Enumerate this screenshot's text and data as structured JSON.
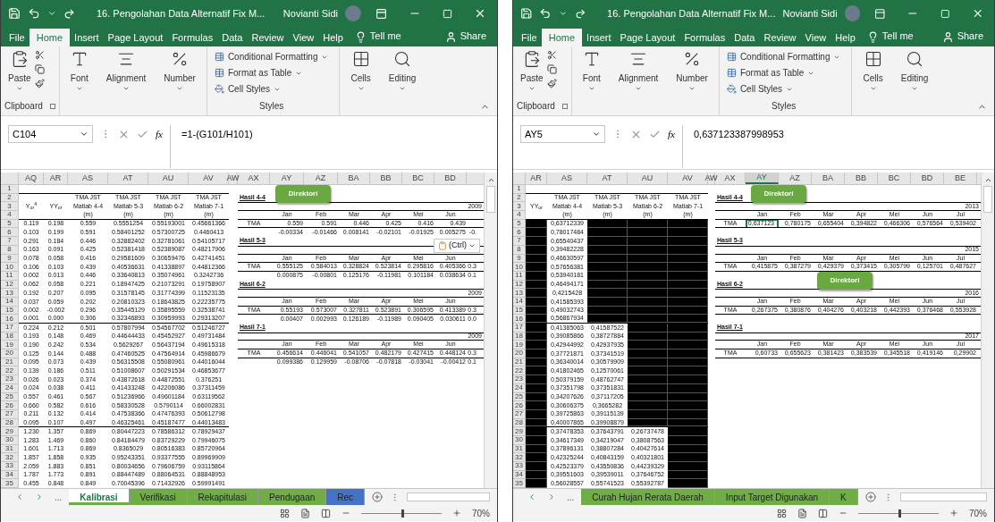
{
  "windows": [
    {
      "title": "16. Pengolahan Data Alternatif Fix M...",
      "user": "Novianti Sidi",
      "tabs": [
        {
          "label": "File",
          "selected": false
        },
        {
          "label": "Home",
          "selected": true
        },
        {
          "label": "Insert",
          "selected": false
        },
        {
          "label": "Page Layout",
          "selected": false
        },
        {
          "label": "Formulas",
          "selected": false
        },
        {
          "label": "Data",
          "selected": false
        },
        {
          "label": "Review",
          "selected": false
        },
        {
          "label": "View",
          "selected": false
        },
        {
          "label": "Help",
          "selected": false
        }
      ],
      "tell_me": "Tell me",
      "share": "Share",
      "ribbon": {
        "paste": "Paste",
        "clipboard": "Clipboard",
        "font": "Font",
        "alignment": "Alignment",
        "number": "Number",
        "styles": [
          "Conditional Formatting",
          "Format as Table",
          "Cell Styles"
        ],
        "styles_label": "Styles",
        "cells": "Cells",
        "editing": "Editing"
      },
      "row_numbers": [
        "1",
        "2",
        "3",
        "4",
        "5",
        "6",
        "7",
        "8",
        "9",
        "10",
        "11",
        "12",
        "13",
        "14",
        "15",
        "16",
        "17",
        "18",
        "19",
        "20",
        "21",
        "22",
        "23",
        "24",
        "25",
        "26",
        "27",
        "28",
        "29",
        "30",
        "31",
        "32",
        "33",
        "34",
        "35"
      ],
      "name_box": "C104",
      "fx": "fx",
      "formula": "=1-(G101/H101)",
      "columns": [
        {
          "name": "AQ",
          "selected": false
        },
        {
          "name": "AR",
          "selected": false
        },
        {
          "name": "AS",
          "selected": false
        },
        {
          "name": "AT",
          "selected": false
        },
        {
          "name": "AU",
          "selected": false
        },
        {
          "name": "AV",
          "selected": false
        },
        {
          "name": "AW",
          "selected": false
        },
        {
          "name": "AX",
          "selected": false
        },
        {
          "name": "AY",
          "selected": false
        },
        {
          "name": "AZ",
          "selected": false
        },
        {
          "name": "BA",
          "selected": false
        },
        {
          "name": "BB",
          "selected": false
        },
        {
          "name": "BC",
          "selected": false
        },
        {
          "name": "BD",
          "selected": false
        }
      ],
      "headers": [
        {
          "lines": [
            "Y$_{or}$$^{4}$"
          ]
        },
        {
          "lines": [
            "YY$_{or}$"
          ]
        },
        {
          "lines": [
            "TMA JST",
            "Matlab 4-4",
            "(m)"
          ]
        },
        {
          "lines": [
            "TMA JST",
            "Matlab 5-3",
            "(m)"
          ]
        },
        {
          "lines": [
            "TMA JST",
            "Matlab 6-2",
            "(m)"
          ]
        },
        {
          "lines": [
            "TMA JST",
            "Matlab 7-1",
            "(m)"
          ]
        }
      ],
      "rows": [
        [
          "0.119",
          "0.198",
          "0.559",
          "0.5551254",
          "0.55193001",
          "0.45661366"
        ],
        [
          "0.103",
          "0.199",
          "0.591",
          "0.58401252",
          "0.57300725",
          "0.4460413"
        ],
        [
          "0.291",
          "0.184",
          "0.446",
          "0.32882402",
          "0.32781061",
          "0.54105717"
        ],
        [
          "0.163",
          "0.091",
          "0.425",
          "0.52381418",
          "0.52389087",
          "0.48217906"
        ],
        [
          "0.078",
          "0.058",
          "0.416",
          "0.29581609",
          "0.30659476",
          "0.42741451"
        ],
        [
          "0.106",
          "0.103",
          "0.439",
          "0.40536631",
          "0.41338897",
          "0.44812366"
        ],
        [
          "0.002",
          "0.013",
          "0.446",
          "0.33640813",
          "0.35074961",
          "0.3242736"
        ],
        [
          "0.062",
          "0.058",
          "0.221",
          "0.18947425",
          "0.21073291",
          "0.19758907"
        ],
        [
          "0.192",
          "0.207",
          "0.095",
          "0.31578145",
          "0.31774399",
          "0.11523135"
        ],
        [
          "0.037",
          "0.059",
          "0.202",
          "0.20810323",
          "0.18643825",
          "0.22235775"
        ],
        [
          "0.002",
          "-0.002",
          "0.296",
          "0.35445129",
          "0.35895559",
          "0.32538741"
        ],
        [
          "0.001",
          "0.000",
          "0.306",
          "0.32346893",
          "0.30959993",
          "0.29313207"
        ],
        [
          "0.224",
          "0.212",
          "0.501",
          "0.57807994",
          "0.54567702",
          "0.51246727"
        ],
        [
          "0.193",
          "0.148",
          "0.469",
          "0.44644433",
          "0.45452927",
          "0.49731484"
        ],
        [
          "0.190",
          "0.242",
          "0.534",
          "0.5629267",
          "0.56437194",
          "0.49615318"
        ],
        [
          "0.125",
          "0.144",
          "0.488",
          "0.47460525",
          "0.47564914",
          "0.45986679"
        ],
        [
          "0.095",
          "0.073",
          "0.439",
          "0.56315508",
          "0.55080961",
          "0.44016044"
        ],
        [
          "0.139",
          "0.186",
          "0.511",
          "0.51008607",
          "0.50291534",
          "0.46853677"
        ],
        [
          "0.026",
          "0.023",
          "0.374",
          "0.43872618",
          "0.44872551",
          "0.376251"
        ],
        [
          "0.024",
          "0.038",
          "0.411",
          "0.41433248",
          "0.42206086",
          "0.37311459"
        ],
        [
          "0.557",
          "0.461",
          "0.567",
          "0.51236966",
          "0.49601184",
          "0.63119562"
        ],
        [
          "0.660",
          "0.582",
          "0.616",
          "0.58330528",
          "0.5790114",
          "0.66002831"
        ],
        [
          "0.211",
          "0.132",
          "0.414",
          "0.47538366",
          "0.47476393",
          "0.50612798"
        ],
        [
          "0.095",
          "0.107",
          "0.497",
          "0.46325461",
          "0.45187477",
          "0.44013483"
        ],
        [
          "1.230",
          "1.357",
          "0.869",
          "0.80447223",
          "0.78586312",
          "0.78929437"
        ],
        [
          "1.283",
          "1.469",
          "0.860",
          "0.84184479",
          "0.83729229",
          "0.79946075"
        ],
        [
          "1.601",
          "1.713",
          "0.869",
          "0.8365029",
          "0.80516383",
          "0.85720964"
        ],
        [
          "1.857",
          "1.858",
          "0.935",
          "0.95243351",
          "0.93377555",
          "0.89969909"
        ],
        [
          "2.059",
          "1.883",
          "0.851",
          "0.80034656",
          "0.79606759",
          "0.93115864"
        ],
        [
          "1.787",
          "1.773",
          "0.891",
          "0.88447489",
          "0.88064531",
          "0.88848953"
        ],
        [
          "0.455",
          "0.848",
          "0.849",
          "0.70045396",
          "0.71432926",
          "0.59991491"
        ]
      ],
      "results": [
        {
          "title": "Hasil 4-4",
          "button": "Direktori",
          "year": "2009",
          "months": [
            "Jan",
            "Feb",
            "Mar",
            "Apr",
            "Mei",
            "Jun"
          ],
          "rows": [
            {
              "label": "TMA",
              "values": [
                "0.559",
                "0.591",
                "0.446",
                "0.425",
                "0.416",
                "0.439"
              ]
            },
            {
              "values": [
                "-0.00334",
                "-0.01466",
                "0.008141",
                "-0.02101",
                "-0.01925",
                "0.005275",
                "-0."
              ]
            }
          ]
        },
        {
          "title": "Hasil 5-3",
          "months": [
            "Jan",
            "Feb",
            "Mar",
            "Apr",
            "Mei",
            "Jun"
          ],
          "rows": [
            {
              "label": "TMA",
              "values": [
                "0.555125",
                "0.584013",
                "0.328824",
                "0.523814",
                "0.295816",
                "0.405366",
                "0.3"
              ]
            },
            {
              "values": [
                "0.000875",
                "-0.00801",
                "0.125176",
                "-0.11981",
                "0.101184",
                "0.038634",
                "0.1"
              ]
            }
          ]
        },
        {
          "title": "Hasil 6-2",
          "year": "2009",
          "months": [
            "Jan",
            "Feb",
            "Mar",
            "Apr",
            "Mei",
            "Jun"
          ],
          "rows": [
            {
              "label": "TMA",
              "values": [
                "0.55193",
                "0.573007",
                "0.327811",
                "0.523891",
                "0.306595",
                "0.413389",
                "0.3"
              ]
            },
            {
              "values": [
                "0.00407",
                "0.002993",
                "0.126189",
                "-0.11989",
                "0.090405",
                "0.030611",
                "0.0"
              ]
            }
          ]
        },
        {
          "title": "Hasil 7-1",
          "year": "2009",
          "months": [
            "Jan",
            "Feb",
            "Mar",
            "Apr",
            "Mei",
            "Jun"
          ],
          "rows": [
            {
              "label": "TMA",
              "values": [
                "0.456614",
                "0.446041",
                "0.541057",
                "0.482179",
                "0.427415",
                "0.448124",
                "0.3"
              ]
            },
            {
              "values": [
                "0.099386",
                "0.129959",
                "-0.08706",
                "-0.07818",
                "-0.03041",
                "-0.00412",
                "0.1"
              ]
            }
          ]
        }
      ],
      "paste_options": "(Ctrl)",
      "sheet_tabs": [
        {
          "label": "Kalibrasi",
          "selected": true,
          "color": "#70ad47"
        },
        {
          "label": "Verifikasi",
          "selected": false,
          "color": "#70ad47"
        },
        {
          "label": "Rekapitulasi",
          "selected": false,
          "color": "#70ad47"
        },
        {
          "label": "Pendugaan",
          "selected": false,
          "color": "#70ad47"
        },
        {
          "label": "Rec",
          "selected": false,
          "color": "#4472c4"
        }
      ],
      "ellipsis": "...",
      "zoom": {
        "label": "70%",
        "level": 0.5
      }
    },
    {
      "title": "16. Pengolahan Data Alternatif Fix M...",
      "user": "Novianti Sidi",
      "tabs": [
        {
          "label": "File",
          "selected": false
        },
        {
          "label": "Home",
          "selected": true
        },
        {
          "label": "Insert",
          "selected": false
        },
        {
          "label": "Page Layout",
          "selected": false
        },
        {
          "label": "Formulas",
          "selected": false
        },
        {
          "label": "Data",
          "selected": false
        },
        {
          "label": "Review",
          "selected": false
        },
        {
          "label": "View",
          "selected": false
        },
        {
          "label": "Help",
          "selected": false
        }
      ],
      "tell_me": "Tell me",
      "share": "Share",
      "ribbon": {
        "paste": "Paste",
        "clipboard": "Clipboard",
        "font": "Font",
        "alignment": "Alignment",
        "number": "Number",
        "styles": [
          "Conditional Formatting",
          "Format as Table",
          "Cell Styles"
        ],
        "styles_label": "Styles",
        "cells": "Cells",
        "editing": "Editing"
      },
      "row_numbers": [
        "1",
        "2",
        "3",
        "4",
        "5",
        "6",
        "7",
        "8",
        "9",
        "10",
        "11",
        "12",
        "13",
        "14",
        "15",
        "16",
        "17",
        "18",
        "19",
        "20",
        "21",
        "22",
        "23",
        "24",
        "25",
        "26",
        "27",
        "28",
        "29",
        "30",
        "31",
        "32",
        "33",
        "34",
        "35"
      ],
      "name_box": "AY5",
      "fx": "fx",
      "formula": "0,637123387998953",
      "columns": [
        {
          "name": "AR",
          "selected": false
        },
        {
          "name": "AS",
          "selected": false
        },
        {
          "name": "AT",
          "selected": false
        },
        {
          "name": "AU",
          "selected": false
        },
        {
          "name": "AV",
          "selected": false
        },
        {
          "name": "AW",
          "selected": false
        },
        {
          "name": "AX",
          "selected": false
        },
        {
          "name": "AY",
          "selected": true
        },
        {
          "name": "AZ",
          "selected": false
        },
        {
          "name": "BA",
          "selected": false
        },
        {
          "name": "BB",
          "selected": false
        },
        {
          "name": "BC",
          "selected": false
        },
        {
          "name": "BD",
          "selected": false
        },
        {
          "name": "BE",
          "selected": false
        }
      ],
      "headers": [
        {
          "lines": [
            "YY$_{or}$"
          ]
        },
        {
          "lines": [
            "TMA JST",
            "Matlab 4-4",
            "(m)"
          ]
        },
        {
          "lines": [
            "TMA JST",
            "Matlab 5-3",
            "(m)"
          ]
        },
        {
          "lines": [
            "TMA JST",
            "Matlab 6-2",
            "(m)"
          ]
        },
        {
          "lines": [
            "TMA JST",
            "Matlab 7-1",
            "(m)"
          ]
        }
      ],
      "rows": [
        [
          null,
          "0,63712339",
          null,
          null,
          null
        ],
        [
          null,
          "0,78017484",
          null,
          null,
          null
        ],
        [
          null,
          "0,65540437",
          null,
          null,
          null
        ],
        [
          null,
          "0,39482228",
          null,
          null,
          null
        ],
        [
          null,
          "0,46630597",
          null,
          null,
          null
        ],
        [
          null,
          "0,57656381",
          null,
          null,
          null
        ],
        [
          null,
          "0,53940181",
          null,
          null,
          null
        ],
        [
          null,
          "0,46494171",
          null,
          null,
          null
        ],
        [
          null,
          "0,4215428",
          null,
          null,
          null
        ],
        [
          null,
          "0,41585393",
          null,
          null,
          null
        ],
        [
          null,
          "0,49032743",
          null,
          null,
          null
        ],
        [
          null,
          "0,56867934",
          null,
          null,
          null
        ],
        [
          null,
          "0,41385063",
          "0,41587522",
          null,
          null
        ],
        [
          null,
          "0,39085866",
          "0,38727884",
          null,
          null
        ],
        [
          null,
          "0,42944992",
          "0,42937935",
          null,
          null
        ],
        [
          null,
          "0,37721871",
          "0,37341519",
          null,
          null
        ],
        [
          null,
          "0,36340014",
          "0,30579909",
          null,
          null
        ],
        [
          null,
          "0,41802465",
          "0,12570061",
          null,
          null
        ],
        [
          null,
          "0,50379159",
          "0,48762747",
          null,
          null
        ],
        [
          null,
          "0,37351798",
          "0,37351831",
          null,
          null
        ],
        [
          null,
          "0,34207626",
          "0,37117205",
          null,
          null
        ],
        [
          null,
          "0,30606375",
          "0,3665282",
          null,
          null
        ],
        [
          null,
          "0,39725863",
          "0,39115139",
          null,
          null
        ],
        [
          null,
          "0,40007865",
          "0,39908879",
          null,
          null
        ],
        [
          null,
          "0,37478353",
          "0,37643791",
          "0,26737478",
          null
        ],
        [
          null,
          "0,34617349",
          "0,34219047",
          "0,38087563",
          null
        ],
        [
          null,
          "0,37896131",
          "0,38807284",
          "0,40427614",
          null
        ],
        [
          null,
          "0,42325244",
          "0,40843159",
          "0,40321801",
          null
        ],
        [
          null,
          "0,42523379",
          "0,43550836",
          "0,44239329",
          null
        ],
        [
          null,
          "0,39551603",
          "0,39539011",
          "0,37646752",
          null
        ],
        [
          null,
          "0,56028557",
          "0,55741523",
          "0,55392787",
          null
        ]
      ],
      "results": [
        {
          "title": "Hasil 4-4",
          "button": "Direktori",
          "year": "2013",
          "months": [
            "Jan",
            "Feb",
            "Mar",
            "Apr",
            "Mei",
            "Jun",
            "Jul"
          ],
          "rows": [
            {
              "label": "TMA",
              "values": [
                "0,637123",
                "0,780175",
                "0,655404",
                "0,394822",
                "0,466306",
                "0,576564",
                "0,539402"
              ]
            }
          ]
        },
        {
          "title": "Hasil 5-3",
          "year": "2015",
          "months": [
            "Jan",
            "Feb",
            "Mar",
            "Apr",
            "Mei",
            "Jun",
            "Jul"
          ],
          "rows": [
            {
              "label": "TMA",
              "values": [
                "0,415875",
                "0,387279",
                "0,429379",
                "0,373415",
                "0,305799",
                "0,125701",
                "0,487627"
              ]
            }
          ]
        },
        {
          "title": "Hasil 6-2",
          "button": "Direktori",
          "year": "2016",
          "months": [
            "Jan",
            "Feb",
            "Mar",
            "Apr",
            "Mei",
            "Jun",
            "Jul"
          ],
          "rows": [
            {
              "label": "TMA",
              "values": [
                "0,267375",
                "0,380876",
                "0,404276",
                "0,403218",
                "0,442393",
                "0,376468",
                "0,553928"
              ]
            }
          ]
        },
        {
          "title": "Hasil 7-1",
          "year": "2017",
          "months": [
            "Jan",
            "Feb",
            "Mar",
            "Apr",
            "Mei",
            "Jun",
            "Jul"
          ],
          "rows": [
            {
              "label": "TMA",
              "values": [
                "0,60733",
                "0,655623",
                "0,381423",
                "0,383539",
                "0,345518",
                "0,419146",
                "0,29902"
              ]
            }
          ]
        }
      ],
      "sheet_tabs": [
        {
          "label": "Curah Hujan Rerata Daerah",
          "selected": false,
          "color": "#70ad47"
        },
        {
          "label": "Input Target Digunakan",
          "selected": false,
          "color": "#70ad47"
        },
        {
          "label": "K",
          "selected": false,
          "color": "#70ad47"
        }
      ],
      "ellipsis": "...",
      "zoom": {
        "label": "70%",
        "level": 0.5
      }
    }
  ]
}
